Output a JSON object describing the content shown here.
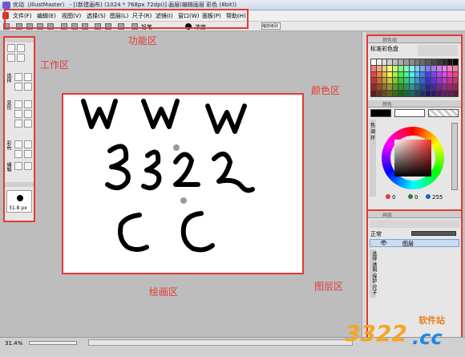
{
  "window": {
    "title": "优动（IllustMaster） - [(新建画布) (1024 * 768px 72dpi)]    画层(编辑画层 彩色 (8bit))"
  },
  "menu": [
    {
      "label": "文件(F)"
    },
    {
      "label": "编辑(E)"
    },
    {
      "label": "视图(V)"
    },
    {
      "label": "选择(S)"
    },
    {
      "label": "图层(L)"
    },
    {
      "label": "尺子(R)"
    },
    {
      "label": "滤镜(I)"
    },
    {
      "label": "窗口(W)"
    },
    {
      "label": "面板(P)"
    },
    {
      "label": "帮助(H)"
    }
  ],
  "toolbar": {
    "brush_label": "铅笔",
    "color_label": "浓度",
    "zoom_label": "缩放级别"
  },
  "annotations": {
    "func": "功能区",
    "work": "工作区",
    "color": "颜色区",
    "draw": "绘画区",
    "layer": "图层区"
  },
  "toolpanel": {
    "sections": [
      "选择",
      "变形",
      "彩色",
      "编辑"
    ],
    "brush_size": "31.8 px"
  },
  "canvas": {
    "lines": [
      "WWW",
      "3322",
      "CC"
    ]
  },
  "colorpanel": {
    "swatch_title": "标准彩色盘",
    "header1": "颜色组",
    "header2": "颜色",
    "rgb": {
      "r": "0",
      "g": "0",
      "b": "255"
    },
    "side_labels": [
      "色",
      "调",
      "环"
    ]
  },
  "layerpanel": {
    "header": "画层",
    "mode": "正常",
    "layer_name": "图层",
    "side_labels": [
      "选择",
      "透明",
      "保护",
      "尺子"
    ]
  },
  "status": {
    "zoom": "31.4%"
  },
  "watermark": {
    "text": "3322",
    "sub": "软件站",
    "cc": ".cc"
  }
}
